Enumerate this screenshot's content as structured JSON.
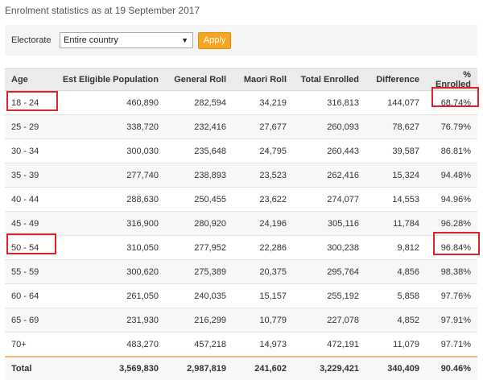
{
  "page": {
    "heading": "Enrolment statistics as at 19 September 2017"
  },
  "filter": {
    "label": "Electorate",
    "selected": "Entire country",
    "apply_label": "Apply"
  },
  "table": {
    "columns": [
      "Age",
      "Est Eligible Population",
      "General Roll",
      "Maori Roll",
      "Total Enrolled",
      "Difference",
      "% Enrolled"
    ],
    "rows": [
      [
        "18 - 24",
        "460,890",
        "282,594",
        "34,219",
        "316,813",
        "144,077",
        "68.74%"
      ],
      [
        "25 - 29",
        "338,720",
        "232,416",
        "27,677",
        "260,093",
        "78,627",
        "76.79%"
      ],
      [
        "30 - 34",
        "300,030",
        "235,648",
        "24,795",
        "260,443",
        "39,587",
        "86.81%"
      ],
      [
        "35 - 39",
        "277,740",
        "238,893",
        "23,523",
        "262,416",
        "15,324",
        "94.48%"
      ],
      [
        "40 - 44",
        "288,630",
        "250,455",
        "23,622",
        "274,077",
        "14,553",
        "94.96%"
      ],
      [
        "45 - 49",
        "316,900",
        "280,920",
        "24,196",
        "305,116",
        "11,784",
        "96.28%"
      ],
      [
        "50 - 54",
        "310,050",
        "277,952",
        "22,286",
        "300,238",
        "9,812",
        "96.84%"
      ],
      [
        "55 - 59",
        "300,620",
        "275,389",
        "20,375",
        "295,764",
        "4,856",
        "98.38%"
      ],
      [
        "60 - 64",
        "261,050",
        "240,035",
        "15,157",
        "255,192",
        "5,858",
        "97.76%"
      ],
      [
        "65 - 69",
        "231,930",
        "216,299",
        "10,779",
        "227,078",
        "4,852",
        "97.91%"
      ],
      [
        "70+",
        "483,270",
        "457,218",
        "14,973",
        "472,191",
        "11,079",
        "97.71%"
      ]
    ],
    "total": [
      "Total",
      "3,569,830",
      "2,987,819",
      "241,602",
      "3,229,421",
      "340,409",
      "90.46%"
    ]
  },
  "colors": {
    "accent_button": "#f5a623",
    "highlight_outline": "#e0202a",
    "total_row_bg": "#fbe8d2"
  }
}
